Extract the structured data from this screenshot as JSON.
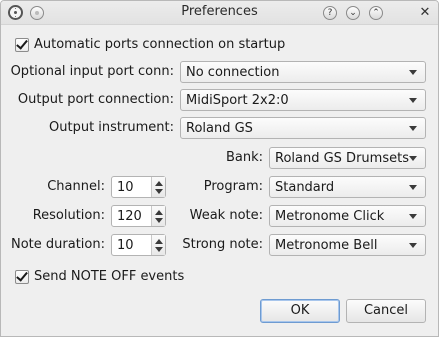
{
  "window": {
    "title": "Preferences"
  },
  "auto_ports": {
    "label": "Automatic ports connection on startup",
    "checked": true
  },
  "input_port": {
    "label": "Optional input port conn:",
    "value": "No connection"
  },
  "output_port": {
    "label": "Output port connection:",
    "value": "MidiSport 2x2:0"
  },
  "output_instrument": {
    "label": "Output instrument:",
    "value": "Roland GS"
  },
  "bank": {
    "label": "Bank:",
    "value": "Roland GS Drumsets"
  },
  "channel": {
    "label": "Channel:",
    "value": "10"
  },
  "program": {
    "label": "Program:",
    "value": "Standard"
  },
  "resolution": {
    "label": "Resolution:",
    "value": "120"
  },
  "weak_note": {
    "label": "Weak note:",
    "value": "Metronome Click"
  },
  "note_duration": {
    "label": "Note duration:",
    "value": "10"
  },
  "strong_note": {
    "label": "Strong note:",
    "value": "Metronome Bell"
  },
  "note_off": {
    "label": "Send NOTE OFF events",
    "checked": true
  },
  "buttons": {
    "ok": "OK",
    "cancel": "Cancel"
  },
  "titlebar_icons": [
    "app-icon",
    "pin-icon",
    "help-icon",
    "minimize-icon",
    "maximize-icon",
    "close-icon"
  ]
}
